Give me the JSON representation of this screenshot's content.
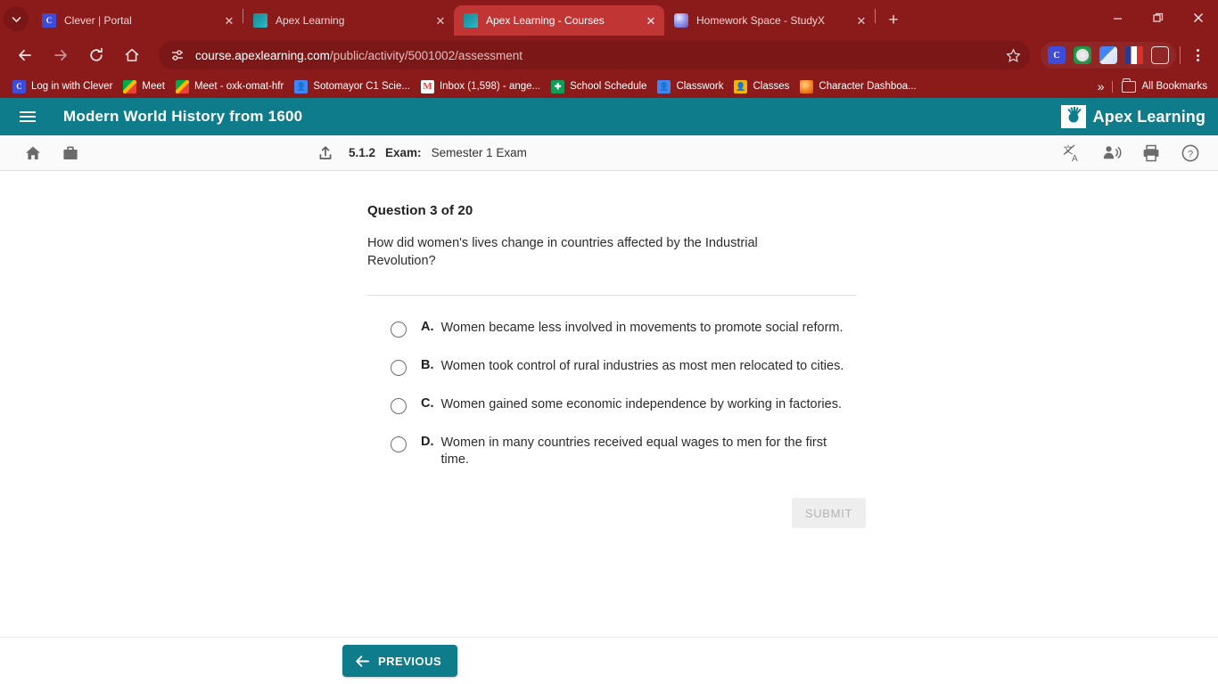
{
  "browser": {
    "tabs": [
      {
        "title": "Clever | Portal",
        "favicon": "clever-icon",
        "active": false
      },
      {
        "title": "Apex Learning",
        "favicon": "apex-icon",
        "active": false
      },
      {
        "title": "Apex Learning - Courses",
        "favicon": "apex-icon",
        "active": true
      },
      {
        "title": "Homework Space - StudyX",
        "favicon": "studyx-icon",
        "active": false
      }
    ],
    "tab_close_label": "✕",
    "new_tab_label": "+",
    "tab_search_icon": "chevron-down-icon",
    "window_controls": {
      "minimize": "—",
      "maximize": "❐",
      "close": "✕"
    },
    "address": {
      "url_host": "course.apexlearning.com",
      "url_path": "/public/activity/5001002/assessment",
      "site_info_icon": "tune-icon",
      "bookmark_icon": "star-icon"
    },
    "extensions": [
      {
        "name": "clever-extension-icon",
        "label": "C"
      },
      {
        "name": "lastpass-extension-icon",
        "label": "LP"
      },
      {
        "name": "translate-extension-icon",
        "label": ""
      },
      {
        "name": "flag-extension-icon",
        "label": ""
      },
      {
        "name": "extensions-puzzle-icon",
        "label": ""
      }
    ],
    "menu_icon": "three-dot-menu-icon",
    "bookmarks": [
      {
        "label": "Log in with Clever",
        "icon": "clever-icon",
        "cls": "ic-clever",
        "glyph": "C"
      },
      {
        "label": "Meet",
        "icon": "google-meet-icon",
        "cls": "ic-meet",
        "glyph": ""
      },
      {
        "label": "Meet - oxk-omat-hfr",
        "icon": "google-meet-icon",
        "cls": "ic-meet",
        "glyph": ""
      },
      {
        "label": "Sotomayor C1 Scie...",
        "icon": "google-contacts-icon",
        "cls": "ic-contacts",
        "glyph": "●"
      },
      {
        "label": "Inbox (1,598) - ange...",
        "icon": "gmail-icon",
        "cls": "ic-gmail",
        "glyph": "M"
      },
      {
        "label": "School Schedule",
        "icon": "google-calendar-icon",
        "cls": "ic-cal",
        "glyph": "✚"
      },
      {
        "label": "Classwork",
        "icon": "google-classroom-icon",
        "cls": "ic-classwork",
        "glyph": "●"
      },
      {
        "label": "Classes",
        "icon": "classes-icon",
        "cls": "ic-classes",
        "glyph": "●"
      },
      {
        "label": "Character Dashboa...",
        "icon": "character-dashboard-icon",
        "cls": "ic-char",
        "glyph": ""
      }
    ],
    "bookmarks_overflow": "»",
    "all_bookmarks_label": "All Bookmarks"
  },
  "apex": {
    "header": {
      "menu_icon": "hamburger-menu-icon",
      "course_title": "Modern World History from 1600",
      "brand_name": "Apex Learning",
      "brand_tm": "®"
    },
    "toolbar": {
      "home_icon": "home-icon",
      "briefcase_icon": "briefcase-icon",
      "up_icon": "move-up-icon",
      "activity_number": "5.1.2",
      "activity_type": "Exam:",
      "activity_name": "Semester 1 Exam",
      "translate_icon": "translate-icon",
      "read_aloud_icon": "read-aloud-icon",
      "print_icon": "print-icon",
      "help_icon": "help-icon"
    },
    "question": {
      "heading": "Question 3 of 20",
      "prompt": "How did women's lives change in countries affected by the Industrial Revolution?",
      "options": [
        {
          "letter": "A.",
          "text": "Women became less involved in movements to promote social reform."
        },
        {
          "letter": "B.",
          "text": "Women took control of rural industries as most men relocated to cities."
        },
        {
          "letter": "C.",
          "text": "Women gained some economic independence by working in factories."
        },
        {
          "letter": "D.",
          "text": "Women in many countries received equal wages to men for the first time."
        }
      ],
      "submit_label": "SUBMIT"
    },
    "footer": {
      "previous_label": "PREVIOUS",
      "previous_icon": "arrow-left-icon"
    }
  },
  "colors": {
    "browser_chrome": "#8b1a1a",
    "apex_teal": "#0e7c8a",
    "active_tab": "#c13535",
    "submit_disabled_bg": "#eeeeee"
  }
}
